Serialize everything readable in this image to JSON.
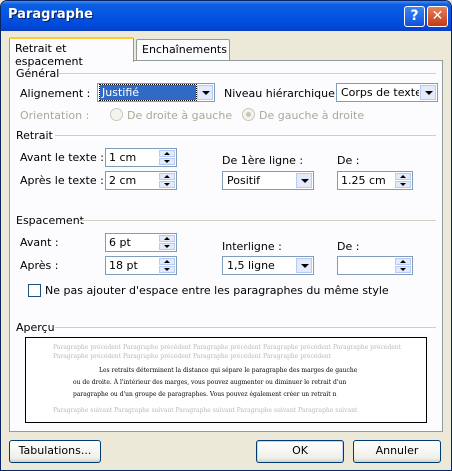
{
  "window": {
    "title": "Paragraphe",
    "help_label": "?",
    "close_label": "✕"
  },
  "tabs": [
    {
      "label": "Retrait et espacement",
      "active": true
    },
    {
      "label": "Enchaînements",
      "active": false
    }
  ],
  "general": {
    "section_label": "Général",
    "alignment_label": "Alignement :",
    "alignment_value": "Justifié",
    "level_label": "Niveau hiérarchique :",
    "level_value": "Corps de texte",
    "orientation_label": "Orientation :",
    "orientation_options": [
      "De droite à gauche",
      "De gauche à droite"
    ]
  },
  "indent": {
    "section_label": "Retrait",
    "before_label": "Avant le texte :",
    "before_value": "1 cm",
    "after_label": "Après le texte :",
    "after_value": "2 cm",
    "first_line_label": "De 1ère ligne :",
    "first_line_value": "Positif",
    "by_label": "De :",
    "by_value": "1.25 cm"
  },
  "spacing": {
    "section_label": "Espacement",
    "before_label": "Avant :",
    "before_value": "6 pt",
    "after_label": "Après :",
    "after_value": "18 pt",
    "line_label": "Interligne :",
    "line_value": "1,5 ligne",
    "at_label": "De :",
    "at_value": "",
    "no_space_label": "Ne pas ajouter d'espace entre les paragraphes du même style"
  },
  "preview": {
    "section_label": "Aperçu",
    "previous_lines": [
      "Paragraphe précédent Paragraphe précédent Paragraphe précédent Paragraphe précédent Paragraphe précédent",
      "Paragraphe précédent Paragraphe précédent Paragraphe précédent Paragraphe précédent"
    ],
    "sample_lines": [
      "Les retraits déterminent la distance qui sépare le paragraphe des marges de gauche",
      "ou de droite. À l'intérieur des marges, vous pouvez augmenter ou diminuer le retrait d'un",
      "paragraphe ou d'un groupe de paragraphes. Vous pouvez également créer un retrait n"
    ],
    "next_lines": [
      "Paragraphe suivant Paragraphe suivant Paragraphe suivant Paragraphe suivant Paragraphe suivant"
    ]
  },
  "buttons": {
    "tabs_label": "Tabulations...",
    "ok_label": "OK",
    "cancel_label": "Annuler"
  }
}
